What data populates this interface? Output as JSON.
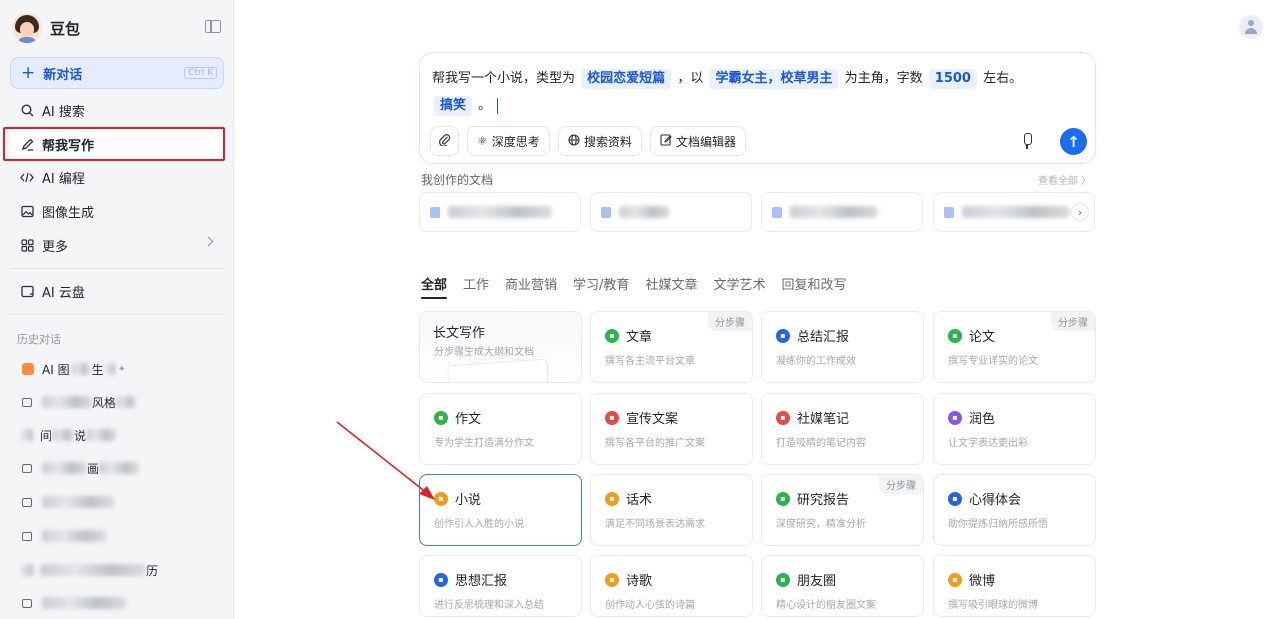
{
  "sidebar": {
    "brand": "豆包",
    "new_chat": {
      "label": "新对话",
      "shortcut": "Ctrl K"
    },
    "nav": [
      {
        "label": "AI 搜索",
        "icon": "search-icon"
      },
      {
        "label": "帮我写作",
        "icon": "pen-icon"
      },
      {
        "label": "AI 编程",
        "icon": "code-icon"
      },
      {
        "label": "图像生成",
        "icon": "image-icon"
      },
      {
        "label": "更多",
        "icon": "grid-icon"
      }
    ],
    "cloud": {
      "label": "AI 云盘",
      "icon": "cloud-disk-icon"
    },
    "history_title": "历史对话",
    "history": [
      {
        "label": "AI 图",
        "suffix": "生"
      },
      {
        "label": "",
        "suffix": "风格"
      },
      {
        "label": "间",
        "suffix": "说"
      },
      {
        "label": "",
        "suffix": "画"
      },
      {
        "label": "",
        "suffix": ""
      },
      {
        "label": "",
        "suffix": ""
      },
      {
        "label": "",
        "suffix": "历"
      },
      {
        "label": "",
        "suffix": ""
      }
    ]
  },
  "composer": {
    "p1": "帮我写一个小说，类型为",
    "chip1": "校园恋爱短篇",
    "p2": "，以",
    "chip2": "学霸女主，校草男主",
    "p3": "为主角，字数",
    "chip3": "1500",
    "p4": "左右。",
    "chip4": "搞笑",
    "p5": "。",
    "tools": [
      "深度思考",
      "搜索资料",
      "文档编辑器"
    ]
  },
  "docs": {
    "title": "我创作的文档",
    "view_all": "查看全部 〉"
  },
  "tabs": [
    "全部",
    "工作",
    "商业营销",
    "学习/教育",
    "社媒文章",
    "文学艺术",
    "回复和改写"
  ],
  "cards": [
    {
      "title": "长文写作",
      "desc": "分步骤生成大纲和文档",
      "step": "",
      "color": ""
    },
    {
      "title": "文章",
      "desc": "撰写各主流平台文章",
      "step": "分步骤",
      "color": "#2cb34a"
    },
    {
      "title": "总结汇报",
      "desc": "凝练你的工作成效",
      "step": "",
      "color": "#2463eb"
    },
    {
      "title": "论文",
      "desc": "撰写专业详实的论文",
      "step": "分步骤",
      "color": "#2cb34a"
    },
    {
      "title": "作文",
      "desc": "专为学生打造满分作文",
      "step": "",
      "color": "#2cb34a"
    },
    {
      "title": "宣传文案",
      "desc": "撰写各平台的推广文案",
      "step": "",
      "color": "#e8484a"
    },
    {
      "title": "社媒笔记",
      "desc": "打造吸睛的笔记内容",
      "step": "",
      "color": "#e8484a"
    },
    {
      "title": "润色",
      "desc": "让文字表达更出彩",
      "step": "",
      "color": "#8b55e3"
    },
    {
      "title": "小说",
      "desc": "创作引人入胜的小说",
      "step": "",
      "color": "#f29c1f"
    },
    {
      "title": "话术",
      "desc": "满足不同场景表达需求",
      "step": "",
      "color": "#f29c1f"
    },
    {
      "title": "研究报告",
      "desc": "深度研究，精准分析",
      "step": "分步骤",
      "color": "#2cb34a"
    },
    {
      "title": "心得体会",
      "desc": "助你提炼归纳所感所悟",
      "step": "",
      "color": "#2463eb"
    },
    {
      "title": "思想汇报",
      "desc": "进行反思梳理和深入总结",
      "step": "",
      "color": "#2463eb"
    },
    {
      "title": "诗歌",
      "desc": "创作动人心弦的诗篇",
      "step": "",
      "color": "#f29c1f"
    },
    {
      "title": "朋友圈",
      "desc": "精心设计的朋友圈文案",
      "step": "",
      "color": "#2cb34a"
    },
    {
      "title": "微博",
      "desc": "撰写吸引眼球的微博",
      "step": "",
      "color": "#f29c1f"
    }
  ]
}
